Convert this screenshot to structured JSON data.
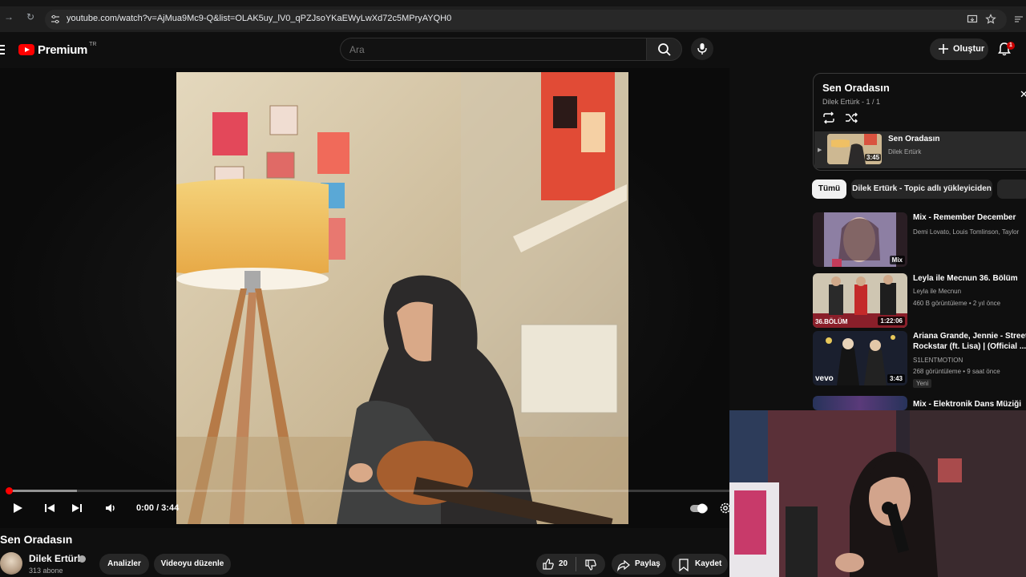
{
  "browser": {
    "url": "youtube.com/watch?v=AjMua9Mc9-Q&list=OLAK5uy_lV0_qPZJsoYKaEWyLwXd72c5MPryAYQH0"
  },
  "header": {
    "logo_text": "Premium",
    "logo_region": "TR",
    "search_placeholder": "Ara",
    "create_label": "Oluştur",
    "notification_count": "1"
  },
  "player": {
    "time": "0:00 / 3:44",
    "progress_fraction": 0.0
  },
  "video": {
    "title": "Sen Oradasın",
    "channel": "Dilek Ertürk",
    "subscribers": "313 abone",
    "analytics_label": "Analizler",
    "edit_label": "Videoyu düzenle",
    "likes": "20",
    "share_label": "Paylaş",
    "save_label": "Kaydet"
  },
  "playlist": {
    "title": "Sen Oradasın",
    "subtitle": "Dilek Ertürk - 1 / 1",
    "item": {
      "title": "Sen Oradasın",
      "channel": "Dilek Ertürk",
      "duration": "3:45"
    }
  },
  "chips": [
    "Tümü",
    "Dilek Ertürk - Topic adlı yükleyiciden"
  ],
  "recommendations": [
    {
      "title": "Mix - Remember December",
      "meta1": "Demi Lovato, Louis Tomlinson, Taylor",
      "tag": "Mix"
    },
    {
      "title": "Leyla ile Mecnun 36. Bölüm",
      "meta1": "Leyla ile Mecnun",
      "meta2": "460 B görüntüleme • 2 yıl önce",
      "thumb_label": "36.BÖLÜM",
      "duration": "1:22:06"
    },
    {
      "title": "Ariana Grande, Jennie - Street Rockstar (ft. Lisa) | (Official ...",
      "meta1": "S1LENTMOTION",
      "meta2": "268 görüntüleme • 9 saat önce",
      "badge": "Yeni",
      "thumb_label": "vevo",
      "duration": "3:43"
    },
    {
      "title": "Mix - Elektronik Dans Müziği"
    }
  ]
}
